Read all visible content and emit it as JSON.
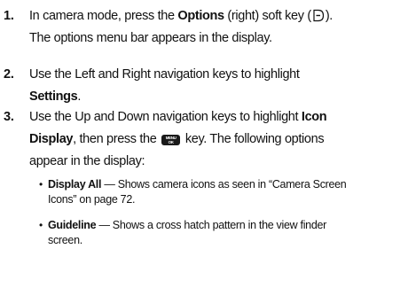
{
  "steps": [
    {
      "number": "1.",
      "line1_a": "In camera mode, press the ",
      "line1_b": "Options",
      "line1_c": " (right) soft key (",
      "line1_d": ").",
      "line2": "The options menu bar appears in the display."
    },
    {
      "number": "2.",
      "line1": "Use the Left and Right navigation keys to highlight",
      "line2_b": "Settings",
      "line2_c": "."
    },
    {
      "number": "3.",
      "line1_a": "Use the Up and Down navigation keys to highlight ",
      "line1_b": "Icon",
      "line2_b": "Display",
      "line2_c": ", then press the ",
      "key_top": "MENU",
      "key_bottom": "OK",
      "line2_d": " key. The following options",
      "line3": "appear in the display:"
    }
  ],
  "bullets": [
    {
      "term": "Display All",
      "line1": " — Shows camera icons as seen in “Camera Screen",
      "line2": "Icons” on page 72."
    },
    {
      "term": "Guideline",
      "line1": " — Shows a cross hatch pattern in the view finder",
      "line2": "screen."
    }
  ],
  "icons": {
    "soft_key": "right-soft-key-icon",
    "menu_ok_key": "menu-ok-key-icon",
    "bullet": "bullet-dot"
  }
}
